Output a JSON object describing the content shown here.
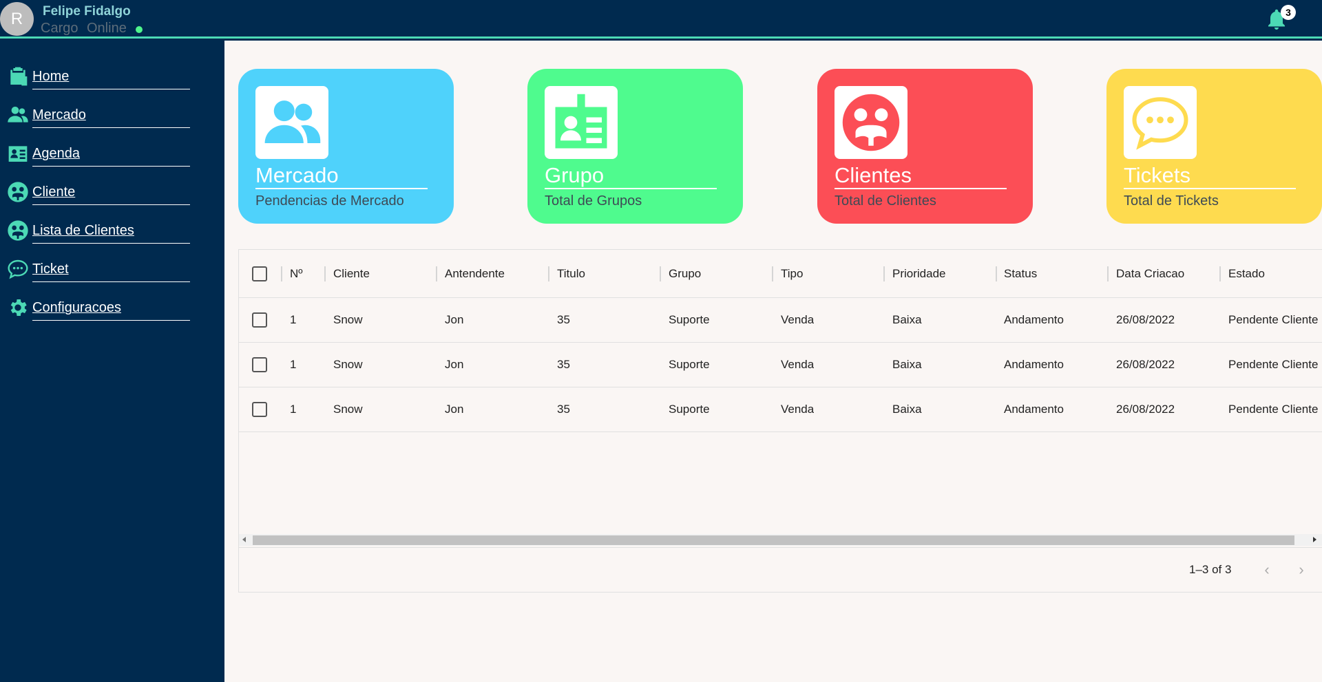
{
  "user": {
    "avatar_letter": "R",
    "name": "Felipe Fidalgo",
    "role": "Cargo",
    "status": "Online"
  },
  "notifications": {
    "count": "3"
  },
  "sidebar": {
    "items": [
      {
        "label": "Home",
        "icon": "clipboard-icon"
      },
      {
        "label": "Mercado",
        "icon": "users-icon"
      },
      {
        "label": "Agenda",
        "icon": "contact-card-icon"
      },
      {
        "label": "Cliente",
        "icon": "client-group-icon"
      },
      {
        "label": "Lista de Clientes",
        "icon": "client-group-icon"
      },
      {
        "label": "Ticket",
        "icon": "chat-bubble-icon"
      },
      {
        "label": "Configuracoes",
        "icon": "gear-icon"
      }
    ]
  },
  "cards": [
    {
      "title": "Mercado",
      "subtitle": "Pendencias de Mercado",
      "color": "#4fd2fb"
    },
    {
      "title": "Grupo",
      "subtitle": "Total de Grupos",
      "color": "#4ffb8e"
    },
    {
      "title": "Clientes",
      "subtitle": "Total de Clientes",
      "color": "#fc4e56"
    },
    {
      "title": "Tickets",
      "subtitle": "Total de Tickets",
      "color": "#fedb4f"
    }
  ],
  "table": {
    "columns": [
      "Nº",
      "Cliente",
      "Antendente",
      "Titulo",
      "Grupo",
      "Tipo",
      "Prioridade",
      "Status",
      "Data Criacao",
      "Estado"
    ],
    "rows": [
      [
        "1",
        "Snow",
        "Jon",
        "35",
        "Suporte",
        "Venda",
        "Baixa",
        "Andamento",
        "26/08/2022",
        "Pendente Cliente"
      ],
      [
        "1",
        "Snow",
        "Jon",
        "35",
        "Suporte",
        "Venda",
        "Baixa",
        "Andamento",
        "26/08/2022",
        "Pendente Cliente"
      ],
      [
        "1",
        "Snow",
        "Jon",
        "35",
        "Suporte",
        "Venda",
        "Baixa",
        "Andamento",
        "26/08/2022",
        "Pendente Cliente"
      ]
    ],
    "pagination": "1–3 of 3"
  }
}
